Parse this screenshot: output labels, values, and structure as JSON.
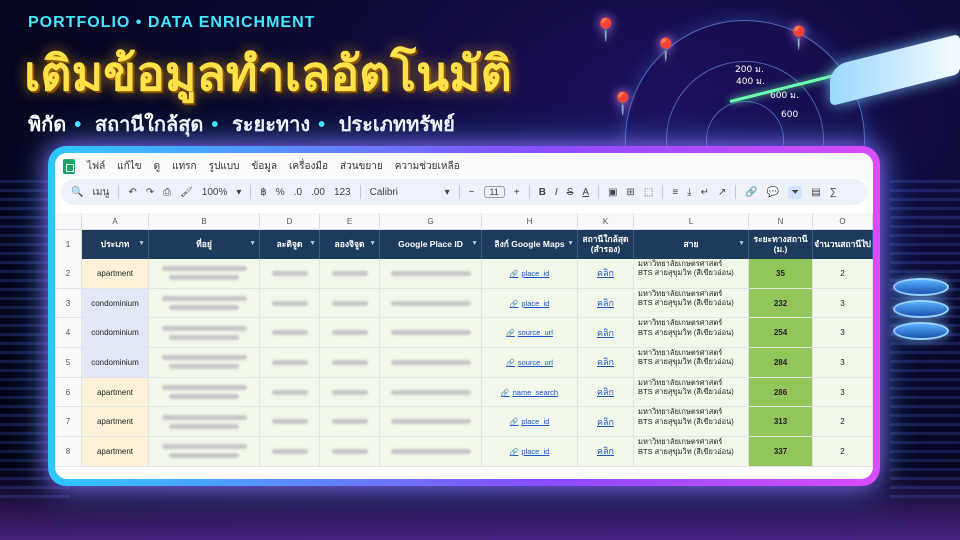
{
  "banner": {
    "eyebrow": "PORTFOLIO • DATA ENRICHMENT",
    "headline": "เติมข้อมูลทำเลอัตโนมัติ",
    "features": [
      "พิกัด",
      "สถานีใกล้สุด",
      "ระยะทาง",
      "ประเภททรัพย์"
    ]
  },
  "radar_labels": [
    "200 ม.",
    "400 ม.",
    "600 ม.",
    "600"
  ],
  "menu": [
    "ไฟล์",
    "แก้ไข",
    "ดู",
    "แทรก",
    "รูปแบบ",
    "ข้อมูล",
    "เครื่องมือ",
    "ส่วนขยาย",
    "ความช่วยเหลือ"
  ],
  "toolbar": {
    "search": "เมนู",
    "zoom": "100%",
    "currency": "฿",
    "percent": "%",
    "decimals": ".0",
    "decimals2": ".00",
    "number_format": "123",
    "font": "Calibri",
    "font_size": "11"
  },
  "columns": [
    "A",
    "B",
    "D",
    "E",
    "G",
    "H",
    "K",
    "L",
    "N",
    "O"
  ],
  "headers": [
    "ประเภท",
    "ที่อยู่",
    "ละติจูด",
    "ลองจิจูด",
    "Google Place ID",
    "ลิงก์ Google Maps",
    "สถานีใกล้สุด (สำรอง)",
    "สาย",
    "ระยะทางสถานี (ม.)",
    "จำนวนสถานีไป"
  ],
  "header_row_num": "1",
  "rows": [
    {
      "num": "2",
      "type": "apartment",
      "link": "place_id",
      "click": "คลิก",
      "line1": "มหาวิทยาลัยเกษตรศาสตร์",
      "line2": "BTS สายสุขุมวิท (สีเขียวอ่อน)",
      "distance": "35",
      "stations": "2"
    },
    {
      "num": "3",
      "type": "condominium",
      "link": "place_id",
      "click": "คลิก",
      "line1": "มหาวิทยาลัยเกษตรศาสตร์",
      "line2": "BTS สายสุขุมวิท (สีเขียวอ่อน)",
      "distance": "232",
      "stations": "3"
    },
    {
      "num": "4",
      "type": "condominium",
      "link": "source_url",
      "click": "คลิก",
      "line1": "มหาวิทยาลัยเกษตรศาสตร์",
      "line2": "BTS สายสุขุมวิท (สีเขียวอ่อน)",
      "distance": "254",
      "stations": "3"
    },
    {
      "num": "5",
      "type": "condominium",
      "link": "source_url",
      "click": "คลิก",
      "line1": "มหาวิทยาลัยเกษตรศาสตร์",
      "line2": "BTS สายสุขุมวิท (สีเขียวอ่อน)",
      "distance": "284",
      "stations": "3"
    },
    {
      "num": "6",
      "type": "apartment",
      "link": "name_search",
      "click": "คลิก",
      "line1": "มหาวิทยาลัยเกษตรศาสตร์",
      "line2": "BTS สายสุขุมวิท (สีเขียวอ่อน)",
      "distance": "286",
      "stations": "3"
    },
    {
      "num": "7",
      "type": "apartment",
      "link": "place_id",
      "click": "คลิก",
      "line1": "มหาวิทยาลัยเกษตรศาสตร์",
      "line2": "BTS สายสุขุมวิท (สีเขียวอ่อน)",
      "distance": "313",
      "stations": "2"
    },
    {
      "num": "8",
      "type": "apartment",
      "link": "place_id",
      "click": "คลิก",
      "line1": "มหาวิทยาลัยเกษตรศาสตร์",
      "line2": "BTS สายสุขุมวิท (สีเขียวอ่อน)",
      "distance": "337",
      "stations": "2"
    }
  ],
  "colors": {
    "accent_cyan": "#45e8ff",
    "headline_yellow": "#ffe14a",
    "header_navy": "#1e3a5c",
    "distance_green": "#93c65a"
  }
}
